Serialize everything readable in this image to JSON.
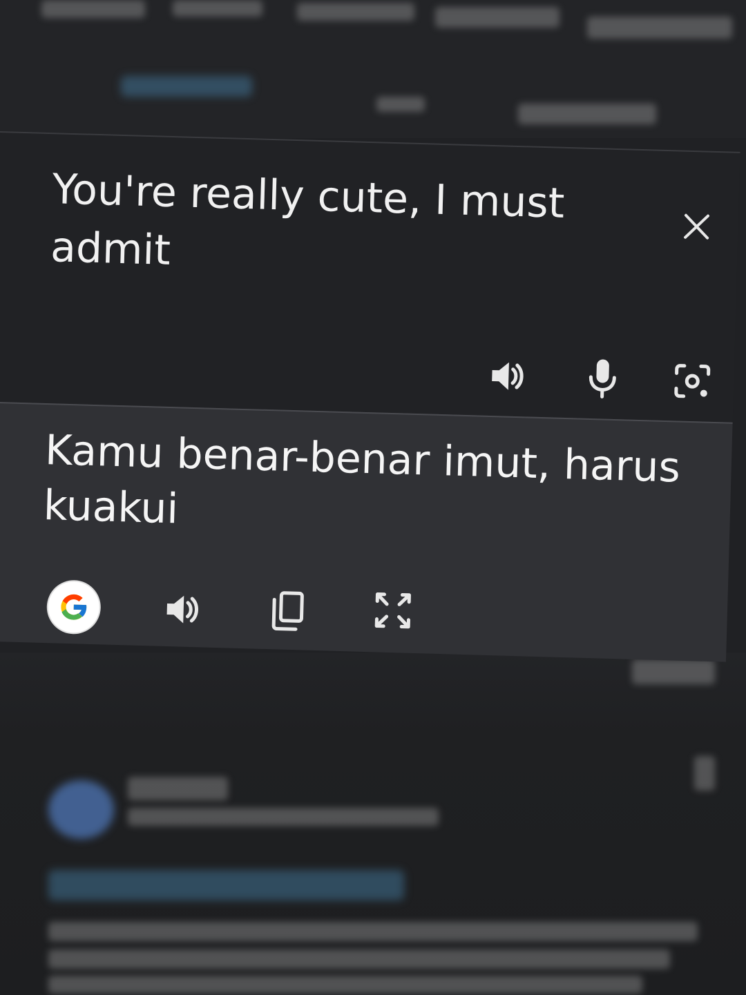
{
  "translation": {
    "source_text": "You're really cute, I must admit",
    "target_text": "Kamu benar-benar imut, harus kuakui"
  },
  "icons": {
    "close": "close-icon",
    "source_speaker": "speaker-icon",
    "microphone": "microphone-icon",
    "camera": "camera-icon",
    "google": "google-logo-icon",
    "target_speaker": "speaker-icon",
    "copy": "copy-icon",
    "fullscreen": "fullscreen-icon"
  },
  "colors": {
    "source_background": "#212225",
    "target_background": "#303135",
    "text": "#f1f1f1",
    "icon": "#e8e8e8"
  }
}
